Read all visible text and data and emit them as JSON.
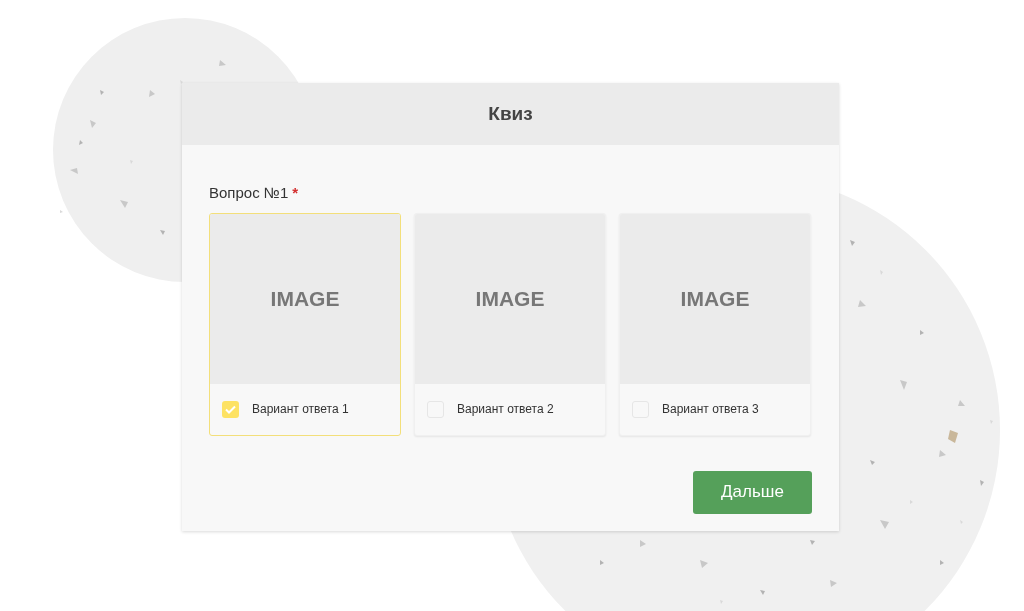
{
  "dialog": {
    "title": "Квиз"
  },
  "question": {
    "label": "Вопрос №1",
    "required_mark": "*"
  },
  "options": [
    {
      "image_text": "IMAGE",
      "label": "Вариант ответа 1",
      "selected": true
    },
    {
      "image_text": "IMAGE",
      "label": "Вариант ответа 2",
      "selected": false
    },
    {
      "image_text": "IMAGE",
      "label": "Вариант ответа 3",
      "selected": false
    }
  ],
  "next_button": "Дальше"
}
